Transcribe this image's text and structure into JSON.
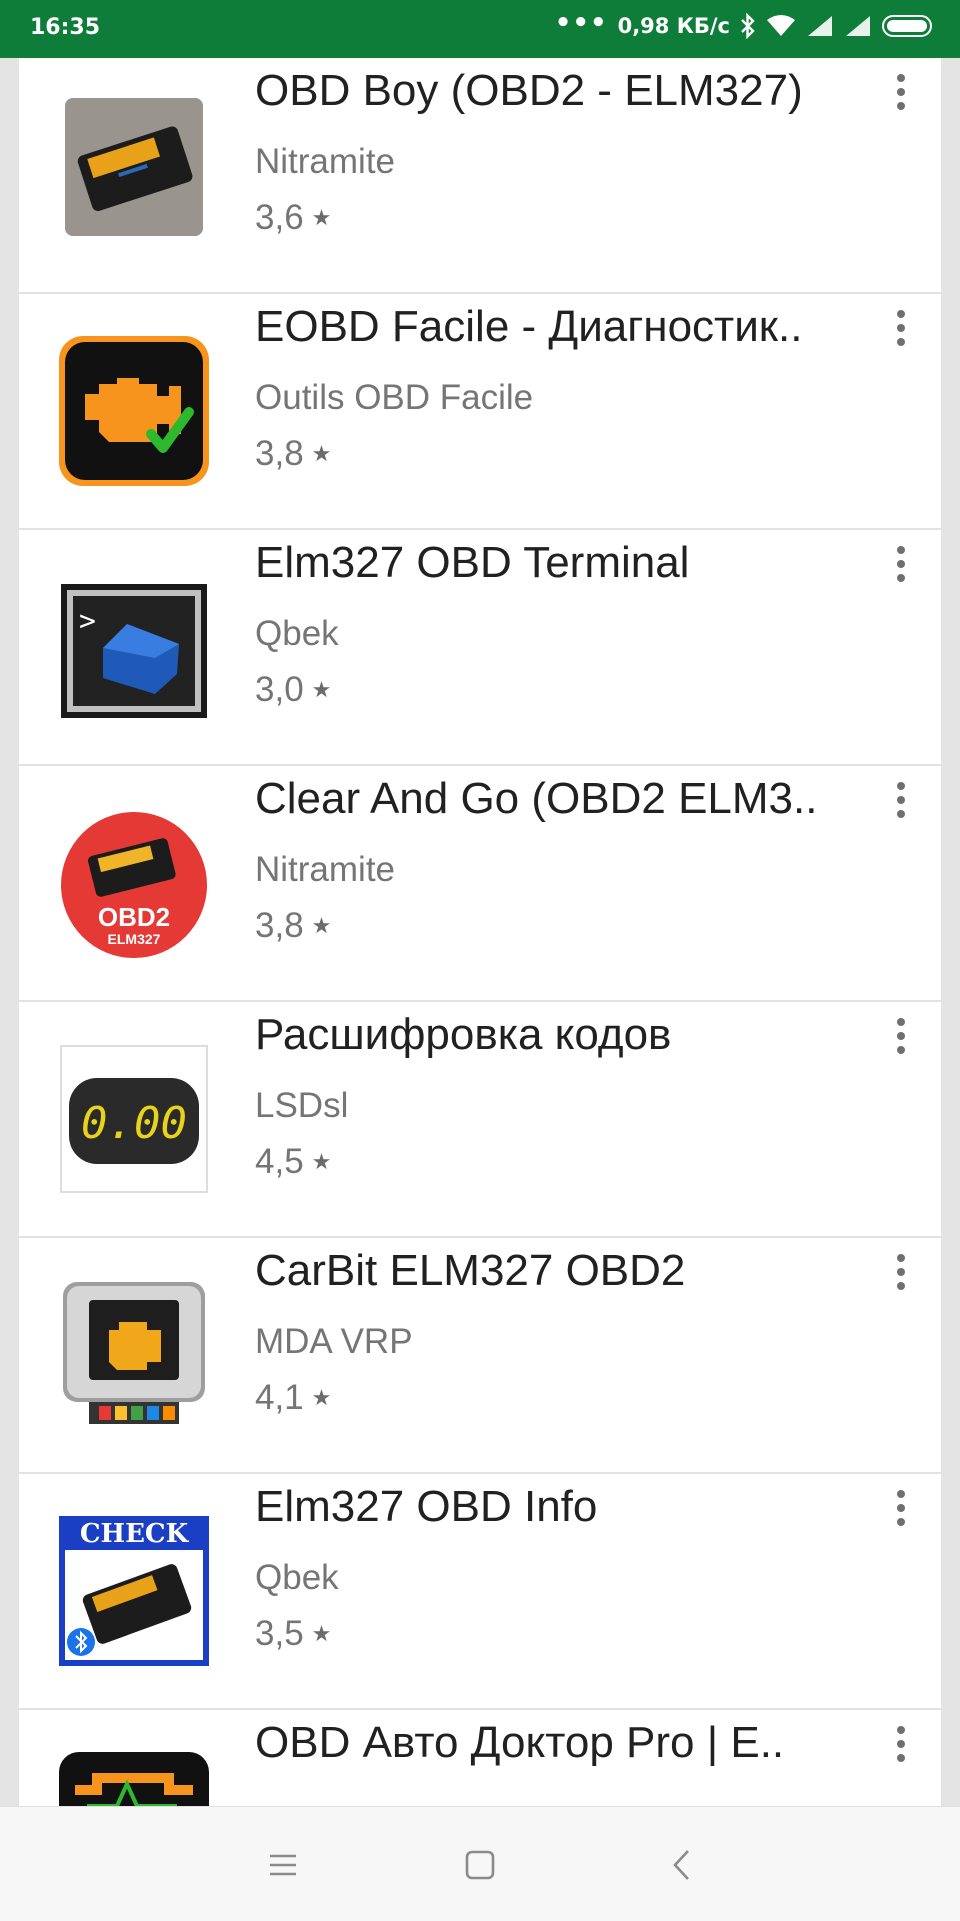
{
  "status_bar": {
    "time": "16:35",
    "speed": "0,98 КБ/с"
  },
  "apps": [
    {
      "title": "OBD Boy (OBD2 - ELM327)",
      "developer": "Nitramite",
      "rating": "3,6"
    },
    {
      "title": "EOBD Facile - Диагностик..",
      "developer": "Outils OBD Facile",
      "rating": "3,8"
    },
    {
      "title": "Elm327 OBD Terminal",
      "developer": "Qbek",
      "rating": "3,0"
    },
    {
      "title": "Clear And Go (OBD2 ELM3..",
      "developer": "Nitramite",
      "rating": "3,8",
      "icon_text": "OBD2",
      "icon_subtext": "ELM327"
    },
    {
      "title": "Расшифровка кодов",
      "developer": "LSDsl",
      "rating": "4,5",
      "icon_text": "0.00"
    },
    {
      "title": "CarBit ELM327 OBD2",
      "developer": "MDA VRP",
      "rating": "4,1"
    },
    {
      "title": "Elm327 OBD Info",
      "developer": "Qbek",
      "rating": "3,5",
      "icon_text": "CHECK"
    },
    {
      "title": "OBD Авто Доктор Pro  | E..",
      "developer": "",
      "rating": ""
    }
  ],
  "star_glyph": "★",
  "colors": {
    "status_bar": "#0f7d3a",
    "obd_orange": "#f7941d",
    "check_green": "#2eb82e"
  },
  "icons": [
    "wifi-icon",
    "bluetooth-icon",
    "signal-icon",
    "battery-icon",
    "more-vert-icon",
    "recent-apps-icon",
    "home-icon",
    "back-icon"
  ]
}
